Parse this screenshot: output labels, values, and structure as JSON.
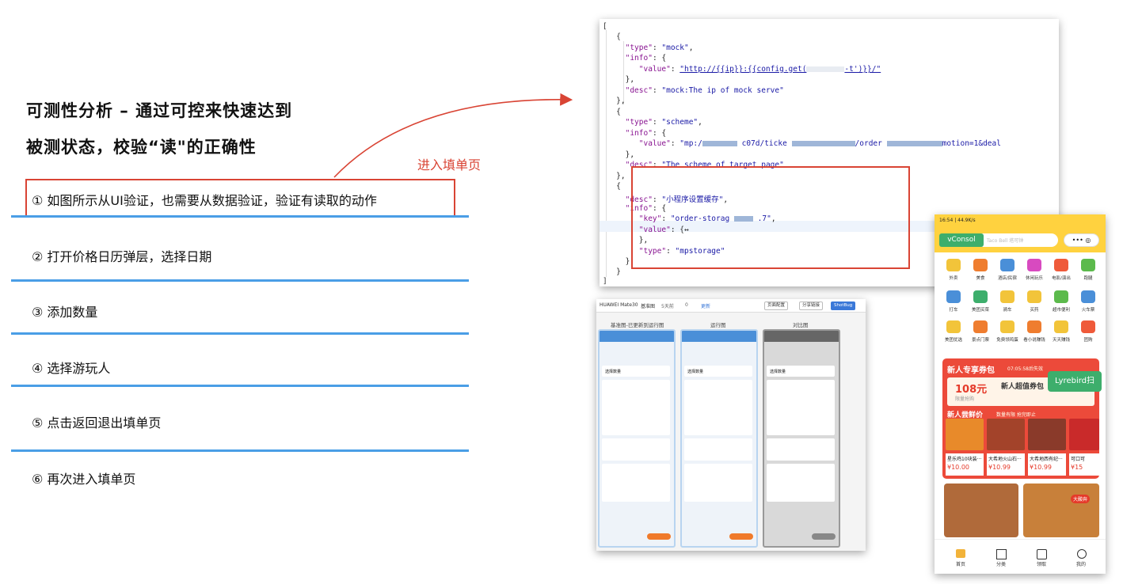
{
  "title_line1": "可测性分析 – 通过可控来快速达到",
  "title_line2": "被测状态，校验“读\"的正确性",
  "annotation": "进入填单页",
  "steps": [
    "① 如图所示从UI验证，也需要从数据验证，验证有读取的动作",
    "② 打开价格日历弹层，选择日期",
    "③ 添加数量",
    "④  选择游玩人",
    "⑤ 点击返回退出填单页",
    "⑥ 再次进入填单页"
  ],
  "code": {
    "type_mock": "\"mock\"",
    "value_mock_a": "\"http://{{ip}}:{{config.get(",
    "value_mock_b": "-t')}}/\"",
    "desc_mock": "\"mock:The ip of mock serve\"",
    "type_scheme": "\"scheme\"",
    "value_scheme_a": "\"mp:/",
    "value_scheme_b": "c07d/ticke",
    "value_scheme_c": "/order",
    "value_scheme_d": "motion=1&deal",
    "desc_scheme": "\"The scheme of target page\"",
    "desc_store": "\"小程序设置缓存\"",
    "key_store_a": "\"order-storag",
    "key_store_b": ".7\"",
    "value_store": "{↔",
    "type_store": "\"mpstorage\""
  },
  "compare_tool": {
    "device": "HUAWEI Mate30",
    "baseline_label": "基准图",
    "time": "5天前",
    "count": "0",
    "update": "更新",
    "btn_config": "页面配置",
    "btn_share": "分享链接",
    "btn_bug": "ShotBug",
    "col1": "基准图-已更新到运行图",
    "col2": "运行图",
    "col3": "对比图",
    "qty_label": "选择数量"
  },
  "app": {
    "status": "16:54 | 44.9K/s",
    "vconsole": "vConsol",
    "search_placeholder": "Taco Bell 塔可钟",
    "capsule": "•••  ◎",
    "icons": [
      "外卖",
      "美食",
      "酒店/民宿",
      "休闲玩乐",
      "电影/演出",
      "跑腿",
      "打车",
      "美团买菜",
      "骑车",
      "买药",
      "超市便利",
      "火车票",
      "美团优选",
      "景点门票",
      "免费领鸡蛋",
      "看小说赚钱",
      "天天赚钱",
      "团购"
    ],
    "banner_title": "新人专享券包",
    "banner_timer": "07:05:58后失效",
    "coupon_amount": "108元",
    "coupon_title": "新人超值券包",
    "coupon_sub": "限量抢购",
    "fresh_title": "新人尝鲜价",
    "fresh_sub": "数量有限 抢完即止",
    "foods": [
      {
        "name": "星乐鸡10块装···",
        "price": "¥10.00"
      },
      {
        "name": "大希地火山石···",
        "price": "¥10.99"
      },
      {
        "name": "大希地西有纪···",
        "price": "¥10.99"
      },
      {
        "name": "可口可",
        "price": "¥15"
      }
    ],
    "big_badge": "大酸奔",
    "tabs": [
      "首页",
      "分类",
      "领取",
      "我的"
    ],
    "lyrebird": "Lyrebird扫"
  }
}
